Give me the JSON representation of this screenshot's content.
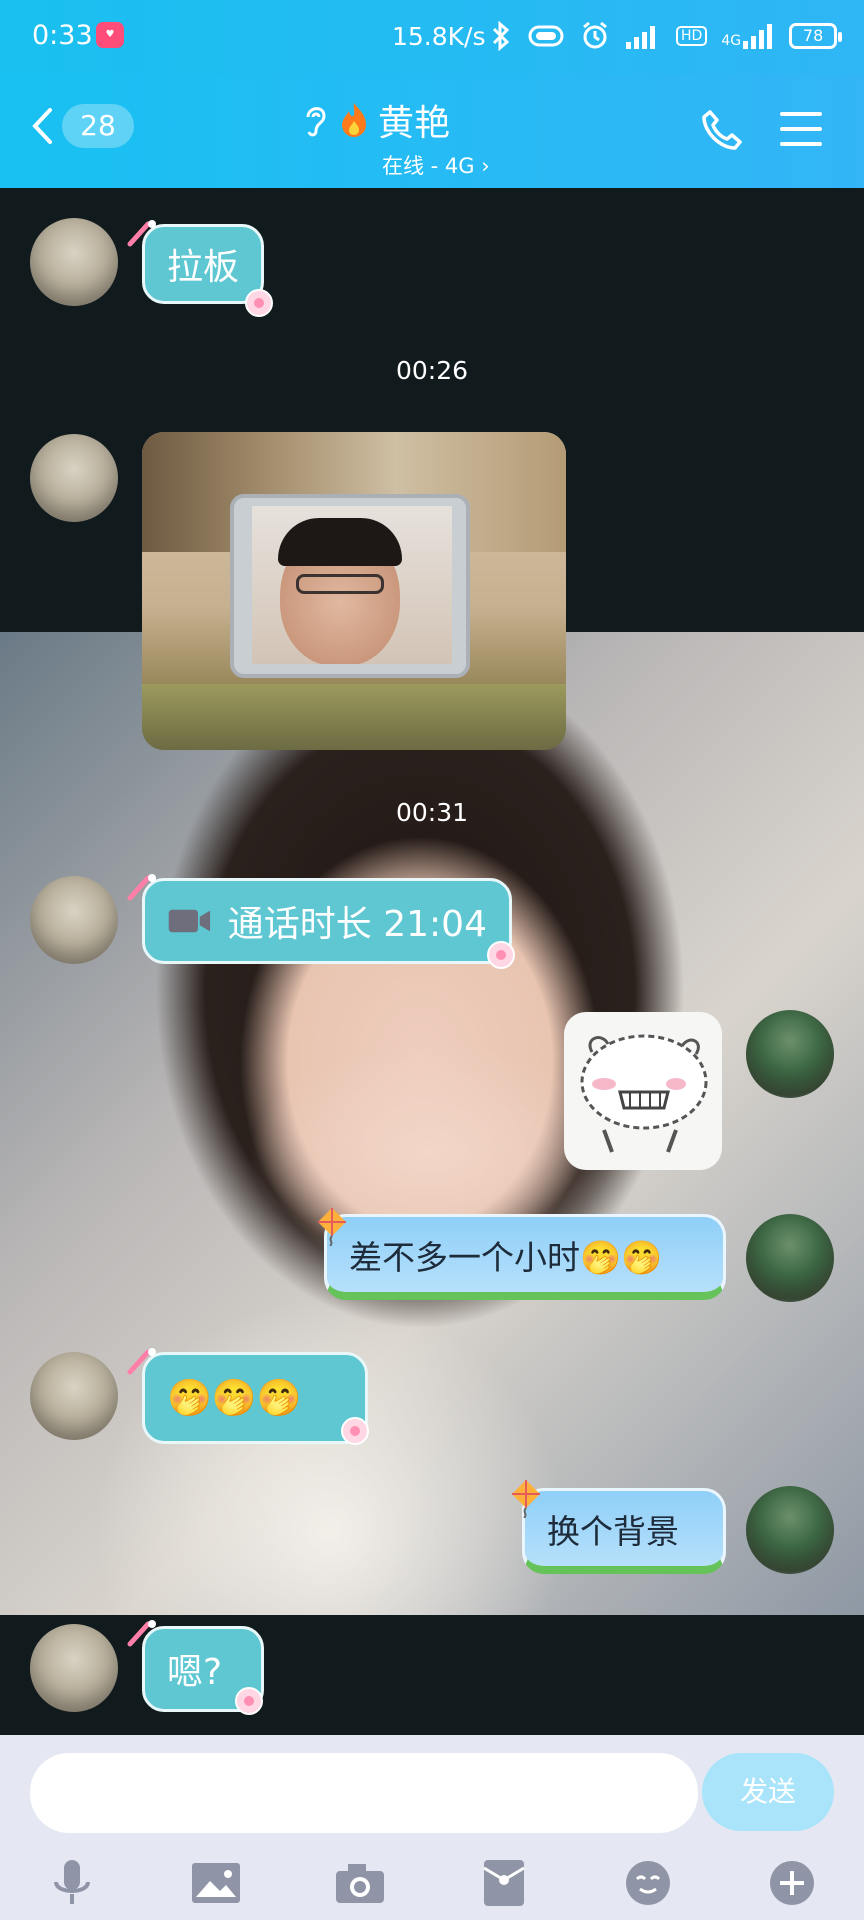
{
  "status_bar": {
    "time": "0:33",
    "net_speed": "15.8K/s",
    "network_type": "4G",
    "hd_label": "HD",
    "battery": "78",
    "icons": [
      "bluetooth-icon",
      "vibrate-icon",
      "alarm-icon",
      "signal-icon",
      "hd-icon",
      "signal-4g-icon",
      "battery-icon"
    ]
  },
  "header": {
    "unread_count": "28",
    "contact_name": "黄艳",
    "contact_status": "在线 - 4G",
    "icons": [
      "back-chevron-icon",
      "ear-icon",
      "fire-icon",
      "phone-icon",
      "menu-icon"
    ]
  },
  "messages": [
    {
      "side": "in",
      "type": "text",
      "text": "拉板"
    },
    {
      "type": "timestamp",
      "text": "00:26"
    },
    {
      "side": "in",
      "type": "image"
    },
    {
      "type": "timestamp",
      "text": "00:31"
    },
    {
      "side": "in",
      "type": "call",
      "text": "通话时长 21:04"
    },
    {
      "side": "out",
      "type": "sticker"
    },
    {
      "side": "out",
      "type": "text",
      "text": "差不多一个小时🤭🤭"
    },
    {
      "side": "in",
      "type": "text",
      "text": "🤭🤭🤭"
    },
    {
      "side": "out",
      "type": "text",
      "text": "换个背景"
    },
    {
      "side": "in",
      "type": "text",
      "text": "嗯?"
    }
  ],
  "composer": {
    "input_value": "",
    "send_label": "发送",
    "tools": [
      "microphone-icon",
      "picture-icon",
      "camera-icon",
      "red-packet-icon",
      "emoji-icon",
      "plus-icon"
    ]
  },
  "colors": {
    "header_start": "#18c1f2",
    "header_end": "#33b5f6",
    "incoming_bubble": "#5ec7d2",
    "outgoing_bubble": "#8fcff8",
    "send_button": "#a9e4fb",
    "composer_bg": "#e5e8f3"
  }
}
